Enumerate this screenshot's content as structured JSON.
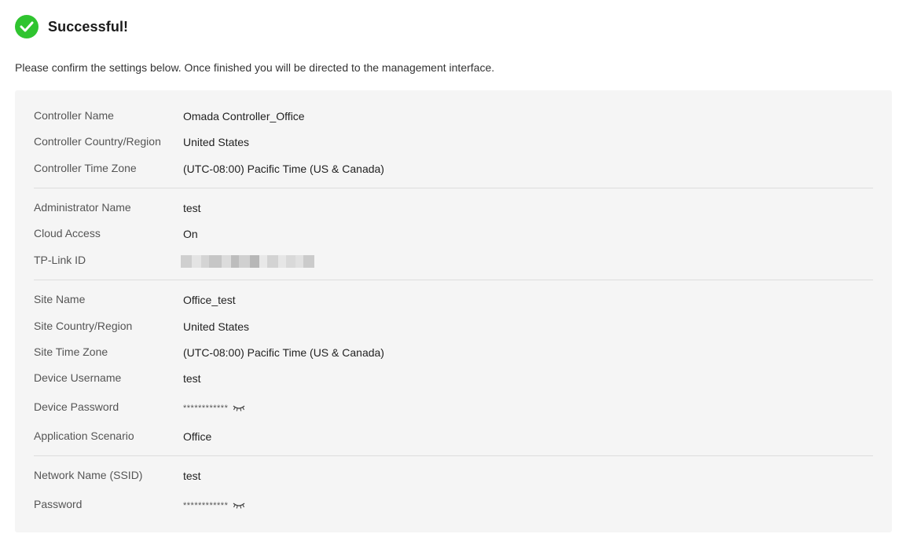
{
  "header": {
    "title": "Successful!",
    "subtitle": "Please confirm the settings below. Once finished you will be directed to the management interface."
  },
  "colors": {
    "success": "#2fc42f",
    "panel_bg": "#f5f5f5",
    "divider": "#dddddd"
  },
  "controller": {
    "name_label": "Controller Name",
    "name_value": "Omada Controller_Office",
    "country_label": "Controller Country/Region",
    "country_value": "United States",
    "timezone_label": "Controller Time Zone",
    "timezone_value": "(UTC-08:00) Pacific Time (US & Canada)"
  },
  "admin": {
    "name_label": "Administrator Name",
    "name_value": "test",
    "cloud_label": "Cloud Access",
    "cloud_value": "On",
    "tplink_label": "TP-Link ID"
  },
  "site": {
    "name_label": "Site Name",
    "name_value": "Office_test",
    "country_label": "Site Country/Region",
    "country_value": "United States",
    "timezone_label": "Site Time Zone",
    "timezone_value": "(UTC-08:00) Pacific Time (US & Canada)",
    "device_user_label": "Device Username",
    "device_user_value": "test",
    "device_pass_label": "Device Password",
    "device_pass_value": "************",
    "scenario_label": "Application Scenario",
    "scenario_value": "Office"
  },
  "wireless": {
    "ssid_label": "Network Name (SSID)",
    "ssid_value": "test",
    "pass_label": "Password",
    "pass_value": "************"
  },
  "icons": {
    "success": "check-circle-icon",
    "reveal": "eye-closed-icon"
  }
}
